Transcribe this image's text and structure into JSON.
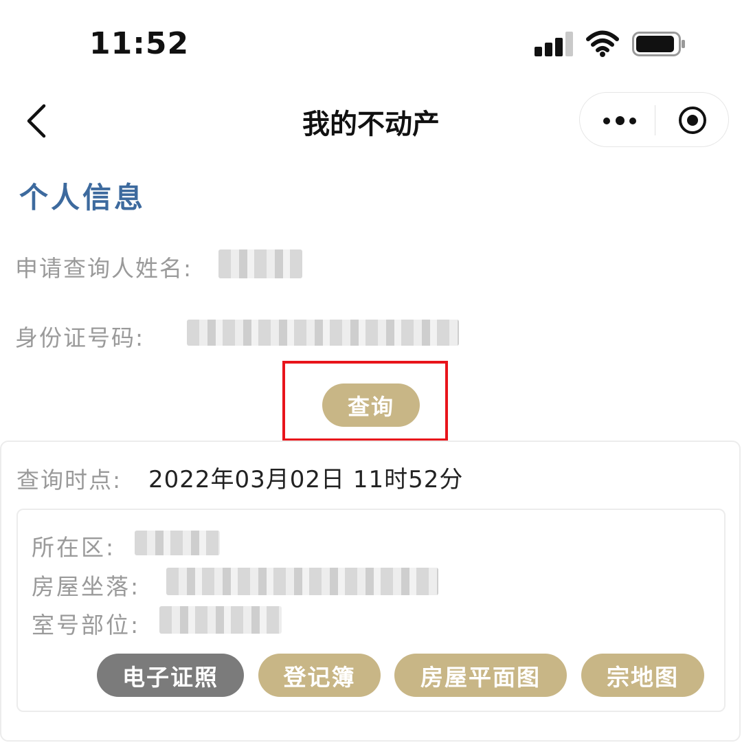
{
  "status_bar": {
    "time": "11:52"
  },
  "nav": {
    "title": "我的不动产"
  },
  "personal": {
    "section_title": "个人信息",
    "name_label": "申请查询人姓名:",
    "id_label": "身份证号码:"
  },
  "query_button": "查询",
  "result": {
    "time_label": "查询时点:",
    "time_value": "2022年03月02日 11时52分",
    "district_label": "所在区:",
    "location_label": "房屋坐落:",
    "room_label": "室号部位:",
    "actions": {
      "e_cert": "电子证照",
      "register": "登记簿",
      "floor_plan": "房屋平面图",
      "land_map": "宗地图"
    }
  },
  "colors": {
    "accent_gold": "#c8b686",
    "title_blue": "#3d6a9e",
    "highlight_red": "#e8141b",
    "button_gray": "#7b7b7b"
  }
}
